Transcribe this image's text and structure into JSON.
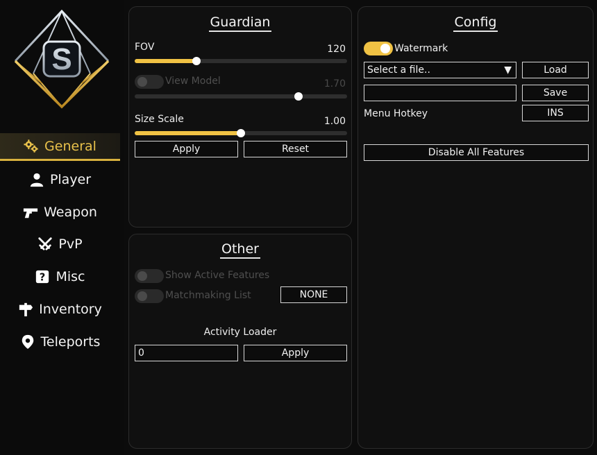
{
  "sidebar": {
    "logo_letter": "S",
    "items": [
      {
        "label": "General",
        "icon": "gears-icon"
      },
      {
        "label": "Player",
        "icon": "person-icon"
      },
      {
        "label": "Weapon",
        "icon": "pistol-icon"
      },
      {
        "label": "PvP",
        "icon": "crossed-swords-icon"
      },
      {
        "label": "Misc",
        "icon": "dice-icon"
      },
      {
        "label": "Inventory",
        "icon": "signpost-icon"
      },
      {
        "label": "Teleports",
        "icon": "map-pin-icon"
      }
    ],
    "active_index": 0
  },
  "guardian": {
    "title": "Guardian",
    "fov": {
      "label": "FOV",
      "value": "120",
      "fraction": 0.29,
      "enabled": true
    },
    "view_model": {
      "label": "View Model",
      "value": "1.70",
      "fraction": 0.77,
      "enabled": false,
      "toggle_on": false
    },
    "size_scale": {
      "label": "Size Scale",
      "value": "1.00",
      "fraction": 0.5,
      "enabled": true
    },
    "apply_label": "Apply",
    "reset_label": "Reset"
  },
  "other": {
    "title": "Other",
    "show_active_features": {
      "label": "Show Active Features",
      "on": false
    },
    "matchmaking_list": {
      "label": "Matchmaking List",
      "on": false,
      "hotkey": "NONE"
    },
    "activity_loader": {
      "label": "Activity Loader",
      "value": "0",
      "apply_label": "Apply"
    }
  },
  "config": {
    "title": "Config",
    "watermark": {
      "label": "Watermark",
      "on": true
    },
    "file_select": {
      "value": "Select a file..",
      "arrow": "▼"
    },
    "load_label": "Load",
    "name_value": "",
    "save_label": "Save",
    "menu_hotkey": {
      "label": "Menu Hotkey",
      "value": "INS"
    },
    "disable_all_label": "Disable All Features"
  },
  "colors": {
    "accent": "#f0c244",
    "panel_bg": "#101010",
    "page_bg": "#0c0c0c"
  }
}
